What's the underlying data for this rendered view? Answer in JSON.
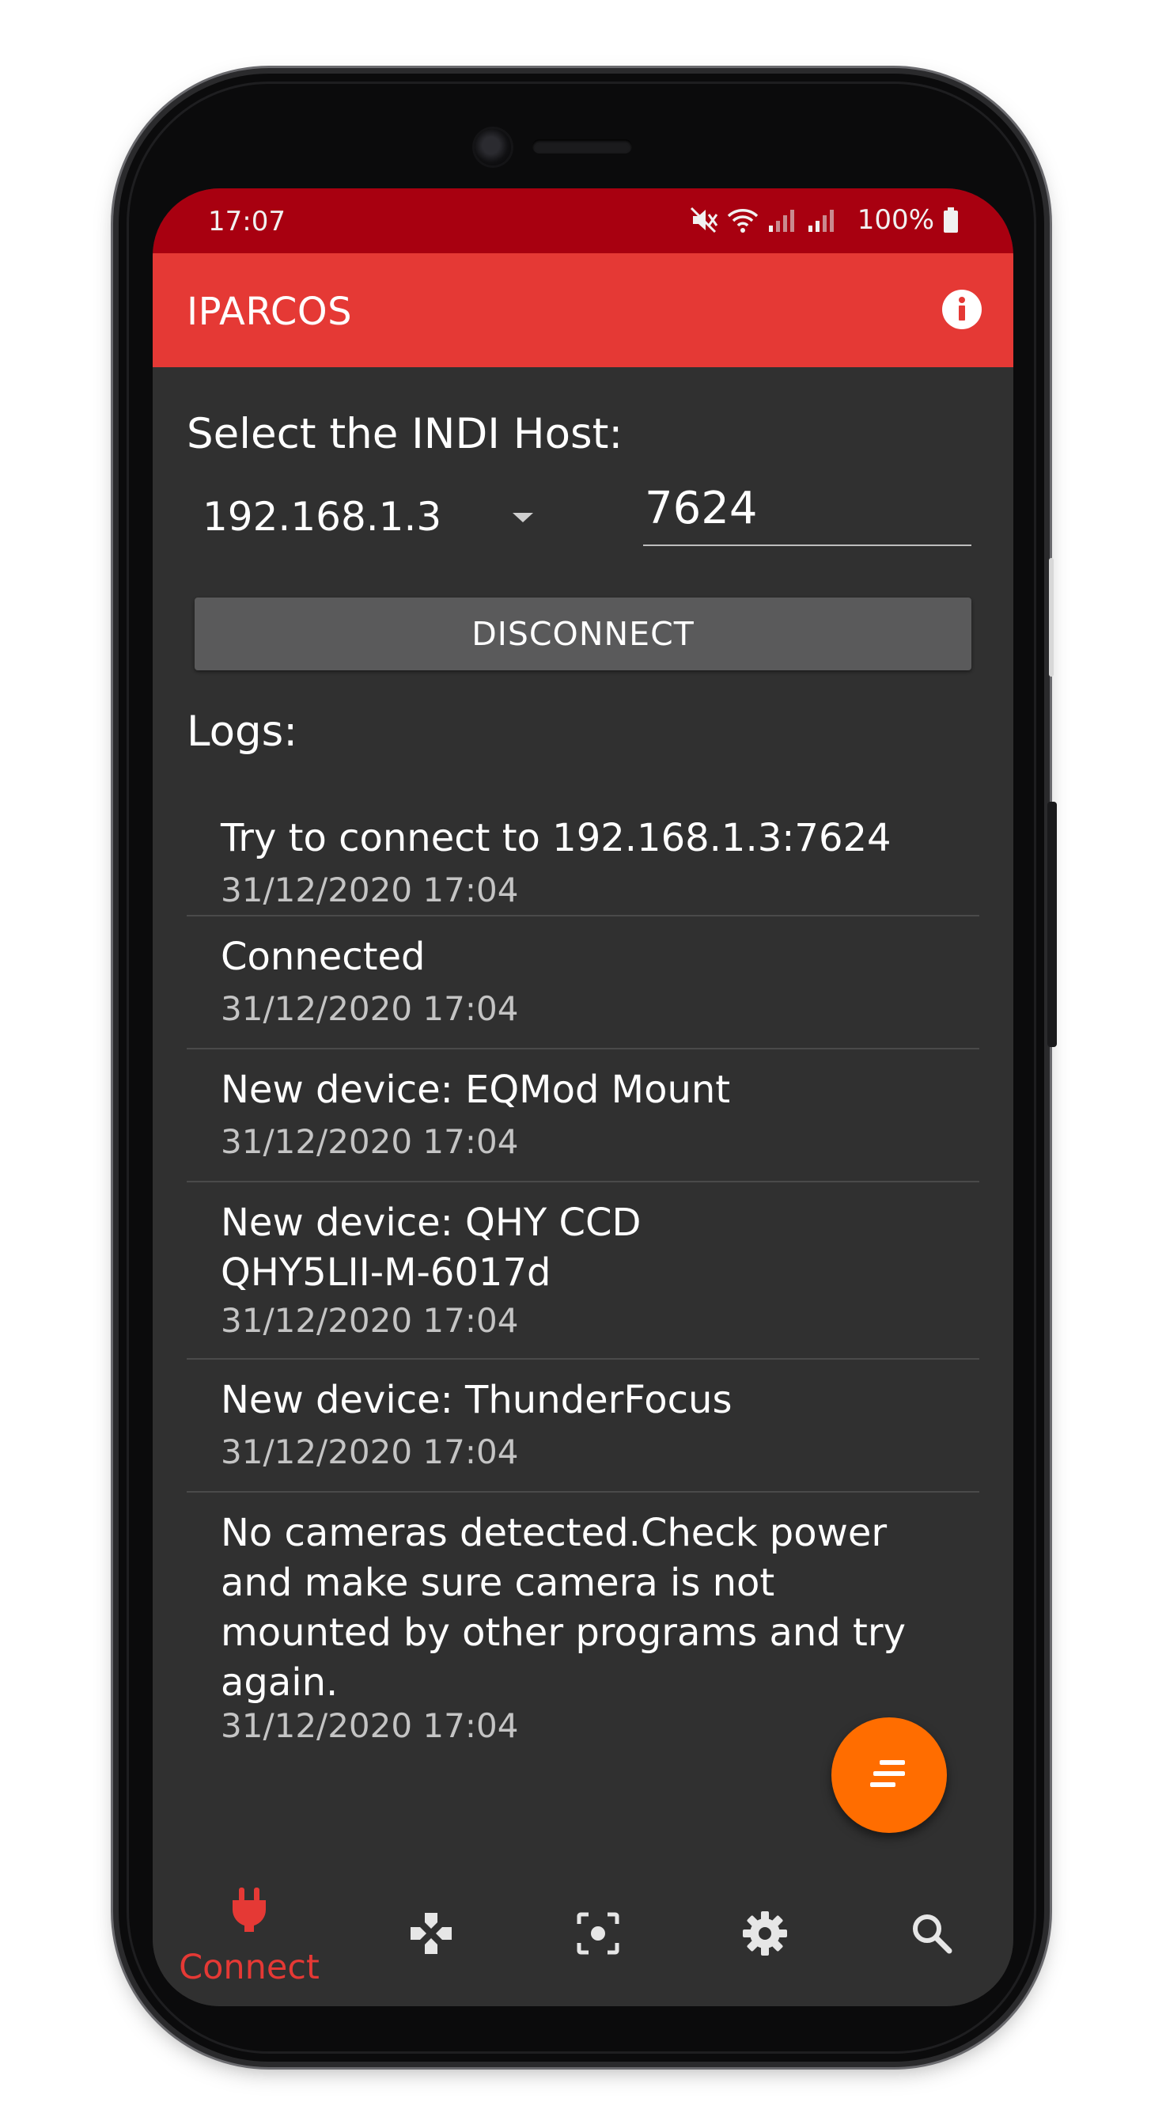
{
  "status_bar": {
    "time": "17:07",
    "battery": "100%"
  },
  "app_bar": {
    "title": "IPARCOS"
  },
  "connect": {
    "host_label": "Select the INDI Host:",
    "host_value": "192.168.1.3",
    "port_value": "7624",
    "disconnect_label": "DISCONNECT",
    "logs_label": "Logs:"
  },
  "logs": [
    {
      "message": "Try to connect to 192.168.1.3:7624",
      "time": "31/12/2020 17:04"
    },
    {
      "message": "Connected",
      "time": "31/12/2020 17:04"
    },
    {
      "message": "New device: EQMod Mount",
      "time": "31/12/2020 17:04"
    },
    {
      "message": "New device: QHY CCD QHY5LII-M-6017d",
      "time": "31/12/2020 17:04"
    },
    {
      "message": "New device: ThunderFocus",
      "time": "31/12/2020 17:04"
    },
    {
      "message": "No cameras detected.Check power and make sure camera is not mounted by other programs and try again.",
      "time": "31/12/2020 17:04"
    }
  ],
  "bottom_nav": {
    "items": [
      {
        "label": "Connect",
        "icon": "plug-icon",
        "active": true
      },
      {
        "label": "",
        "icon": "gamepad-icon",
        "active": false
      },
      {
        "label": "",
        "icon": "camera-focus-icon",
        "active": false
      },
      {
        "label": "",
        "icon": "gear-icon",
        "active": false
      },
      {
        "label": "",
        "icon": "search-icon",
        "active": false
      }
    ]
  },
  "colors": {
    "status_bar": "#a80010",
    "app_bar": "#e53935",
    "background": "#303030",
    "button": "#5a5a5b",
    "fab": "#ff6d00",
    "active_nav": "#e53935"
  }
}
